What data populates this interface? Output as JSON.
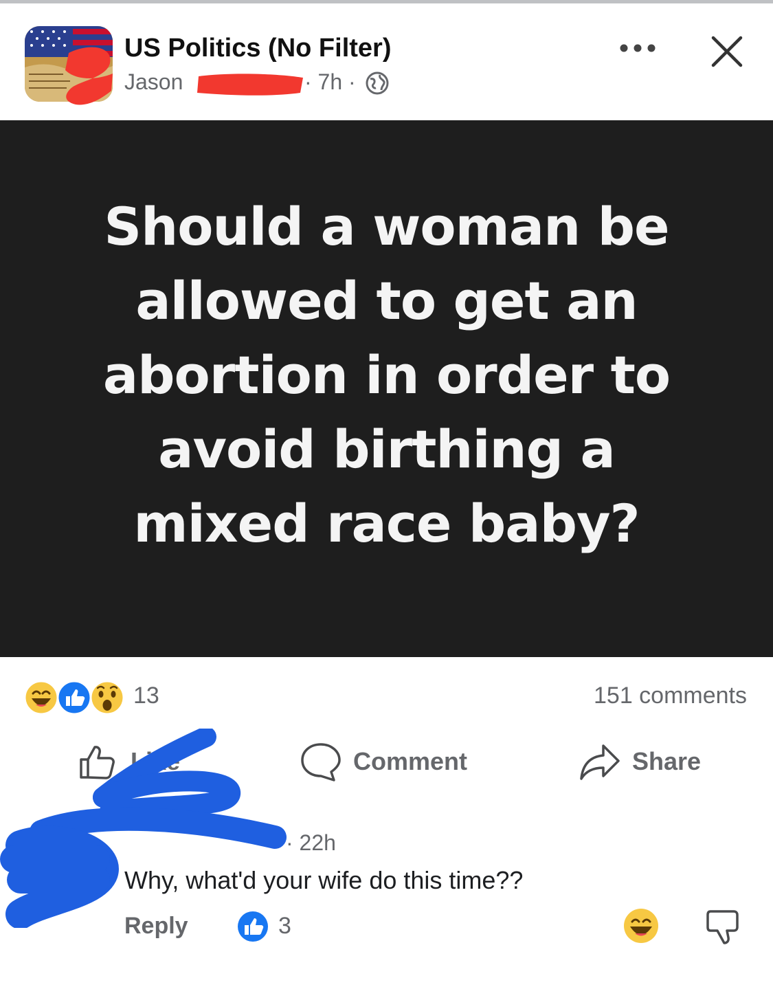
{
  "header": {
    "group_name": "US Politics (No Filter)",
    "author_name": "Jason",
    "post_time": "· 7h ·",
    "privacy_icon": "globe-icon",
    "more_icon": "more-horizontal-icon",
    "close_icon": "close-icon"
  },
  "post": {
    "image_text": "Should a woman be allowed to get an abortion in order to avoid birthing a mixed race baby?",
    "background_color": "#1e1e1e",
    "text_color": "#f4f4f4"
  },
  "reactions": {
    "icons": [
      "haha-icon",
      "like-icon",
      "wow-icon"
    ],
    "count": "13",
    "comments": "151 comments"
  },
  "actions": {
    "like_label": "Like",
    "comment_label": "Comment",
    "share_label": "Share"
  },
  "comment": {
    "time": "· 22h",
    "text": "Why, what'd your wife do this time??",
    "reply_label": "Reply",
    "like_count": "3",
    "react_icon": "haha-icon",
    "dislike_icon": "thumbs-down-icon"
  },
  "colors": {
    "facebook_blue": "#1877f2",
    "secondary_text": "#65676b",
    "red_redaction": "#f2382f",
    "blue_redaction": "#1f5fe0"
  }
}
